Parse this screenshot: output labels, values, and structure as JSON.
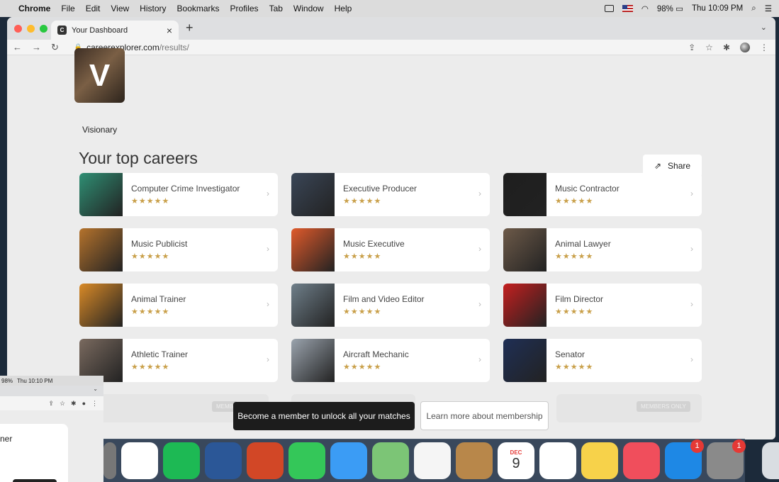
{
  "menubar": {
    "items": [
      "Chrome",
      "File",
      "Edit",
      "View",
      "History",
      "Bookmarks",
      "Profiles",
      "Tab",
      "Window",
      "Help"
    ],
    "battery": "98%",
    "clock": "Thu 10:09 PM"
  },
  "browser": {
    "tab_title": "Your Dashboard",
    "url_domain": "careerexplorer.com",
    "url_path": "/results/"
  },
  "profile": {
    "letter": "V",
    "label": "Visionary"
  },
  "page": {
    "headline": "Your top careers",
    "share_label": "Share",
    "members_only": "MEMBERS ONLY",
    "members_short": "MEMB",
    "toast_dark": "Become a member to unlock all your matches",
    "toast_light": "Learn more about membership"
  },
  "careers": [
    {
      "title": "Computer Crime Investigator",
      "stars": "★★★★★",
      "thumb": "#2f8f74"
    },
    {
      "title": "Executive Producer",
      "stars": "★★★★★",
      "thumb": "#3a4657"
    },
    {
      "title": "Music Contractor",
      "stars": "★★★★★",
      "thumb": "#1e1e1e"
    },
    {
      "title": "Music Publicist",
      "stars": "★★★★★",
      "thumb": "#b5732c"
    },
    {
      "title": "Music Executive",
      "stars": "★★★★★",
      "thumb": "#e05a2b"
    },
    {
      "title": "Animal Lawyer",
      "stars": "★★★★★",
      "thumb": "#6d5a49"
    },
    {
      "title": "Animal Trainer",
      "stars": "★★★★★",
      "thumb": "#d98a27"
    },
    {
      "title": "Film and Video Editor",
      "stars": "★★★★★",
      "thumb": "#6f7f8a"
    },
    {
      "title": "Film Director",
      "stars": "★★★★★",
      "thumb": "#c41f1f"
    },
    {
      "title": "Athletic Trainer",
      "stars": "★★★★★",
      "thumb": "#7a6a5f"
    },
    {
      "title": "Aircraft Mechanic",
      "stars": "★★★★★",
      "thumb": "#9aa3ad"
    },
    {
      "title": "Senator",
      "stars": "★★★★★",
      "thumb": "#1f2f55"
    }
  ],
  "background_window": {
    "battery": "98%",
    "clock": "Thu 10:10 PM",
    "panel_text": "ner"
  },
  "dock": [
    {
      "name": "Chrome",
      "color": "#ffffff"
    },
    {
      "name": "Spotify",
      "color": "#1db954"
    },
    {
      "name": "Word",
      "color": "#2b5797"
    },
    {
      "name": "PowerPoint",
      "color": "#d24726"
    },
    {
      "name": "FaceTime",
      "color": "#34c759"
    },
    {
      "name": "Messages",
      "color": "#3b9cf5"
    },
    {
      "name": "Maps",
      "color": "#7cc576"
    },
    {
      "name": "Photos",
      "color": "#f5f5f5"
    },
    {
      "name": "Contacts",
      "color": "#b8874a"
    },
    {
      "name": "Calendar",
      "color": "#ffffff",
      "month": "DEC",
      "day": "9"
    },
    {
      "name": "Reminders",
      "color": "#ffffff"
    },
    {
      "name": "Notes",
      "color": "#f7d24a"
    },
    {
      "name": "Music",
      "color": "#f04e5c"
    },
    {
      "name": "App Store",
      "color": "#1e88e5",
      "badge": "1"
    },
    {
      "name": "System Preferences",
      "color": "#8a8a8a",
      "badge": "1"
    },
    {
      "name": "Trash",
      "color": "#d9dde2"
    }
  ]
}
